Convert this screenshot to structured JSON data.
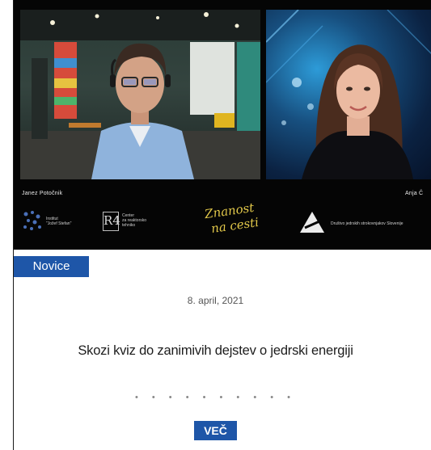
{
  "video": {
    "participant_left": "Janez Potočnik",
    "participant_right": "Anja Č"
  },
  "logos": {
    "institute_line1": "Institut",
    "institute_line2": "\"Jožef Stefan\"",
    "r4_mark": "R4",
    "r4_line1": "Center",
    "r4_line2": "za reaktorsko",
    "r4_line3": "tehniko",
    "script_line1": "Znanost",
    "script_line2": "na cesti",
    "society_text": "Društvo jedrskih strokovnjakov Slovenije"
  },
  "section": {
    "tab_label": "Novice"
  },
  "news": {
    "date": "8. april, 2021",
    "title": "Skozi kviz do zanimivih dejstev o jedrski energiji",
    "pagination_dots": "• • • • • • • • • •",
    "more_label": "VEČ"
  },
  "colors": {
    "accent": "#1e56a8",
    "video_background": "#050505"
  }
}
